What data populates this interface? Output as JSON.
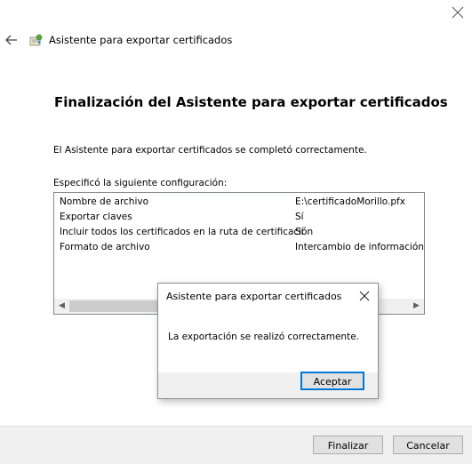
{
  "wizard": {
    "title": "Asistente para exportar certificados",
    "heading": "Finalización del Asistente para exportar certificados",
    "message": "El Asistente para exportar certificados se completó correctamente.",
    "config_label": "Especificó la siguiente configuración:",
    "settings": [
      {
        "key": "Nombre de archivo",
        "value": "E:\\certificadoMorillo.pfx"
      },
      {
        "key": "Exportar claves",
        "value": "Sí"
      },
      {
        "key": "Incluir todos los certificados en la ruta de certificación",
        "value": "Sí"
      },
      {
        "key": "Formato de archivo",
        "value": "Intercambio de información pe"
      }
    ],
    "buttons": {
      "finish": "Finalizar",
      "cancel": "Cancelar"
    },
    "icons": {
      "close": "close-icon",
      "back": "back-arrow-icon",
      "wizard": "certificate-icon"
    }
  },
  "dialog": {
    "title": "Asistente para exportar certificados",
    "message": "La exportación se realizó correctamente.",
    "ok_label": "Aceptar"
  },
  "colors": {
    "accent": "#0078d7",
    "footer_bg": "#f0f0f0",
    "button_bg": "#e1e1e1"
  }
}
